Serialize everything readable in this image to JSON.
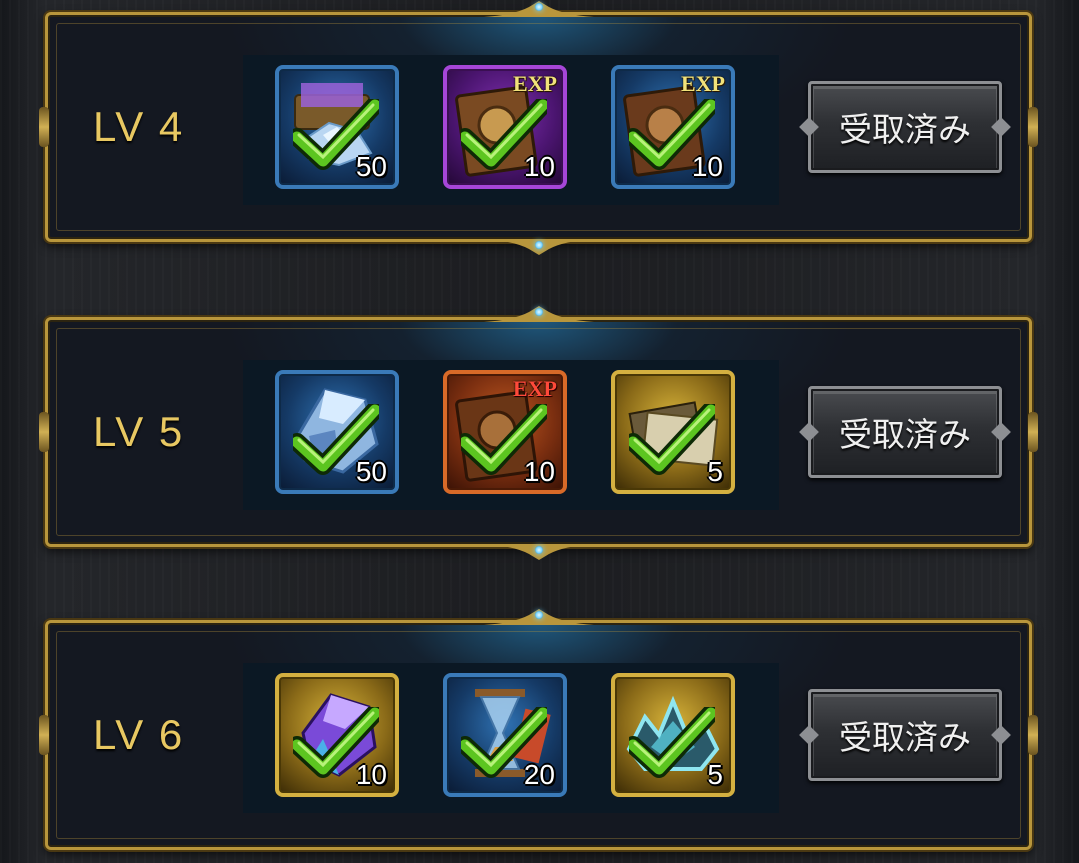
{
  "tiers": [
    {
      "level": "LV 4",
      "button_label": "受取済み",
      "rewards": [
        {
          "icon": "treasure-chest-icon",
          "frame": "blue",
          "quantity": "50",
          "exp_tag": ""
        },
        {
          "icon": "exp-book-icon",
          "frame": "purple",
          "quantity": "10",
          "exp_tag": "EXP"
        },
        {
          "icon": "exp-book-icon",
          "frame": "blue",
          "quantity": "10",
          "exp_tag": "EXP"
        }
      ]
    },
    {
      "level": "LV 5",
      "button_label": "受取済み",
      "rewards": [
        {
          "icon": "crystal-ore-icon",
          "frame": "blue",
          "quantity": "50",
          "exp_tag": ""
        },
        {
          "icon": "exp-book-icon",
          "frame": "orange",
          "quantity": "10",
          "exp_tag": "EXP"
        },
        {
          "icon": "invitation-letter-icon",
          "frame": "gold",
          "quantity": "5",
          "exp_tag": ""
        }
      ]
    },
    {
      "level": "LV 6",
      "button_label": "受取済み",
      "rewards": [
        {
          "icon": "purple-gem-icon",
          "frame": "gold",
          "quantity": "10",
          "exp_tag": ""
        },
        {
          "icon": "hourglass-icon",
          "frame": "blue",
          "quantity": "20",
          "exp_tag": ""
        },
        {
          "icon": "crown-emblem-icon",
          "frame": "gold",
          "quantity": "5",
          "exp_tag": ""
        }
      ]
    }
  ],
  "colors": {
    "level_text": "#e8c862",
    "panel_border": "#b8963c",
    "check_green": "#5cc520"
  }
}
